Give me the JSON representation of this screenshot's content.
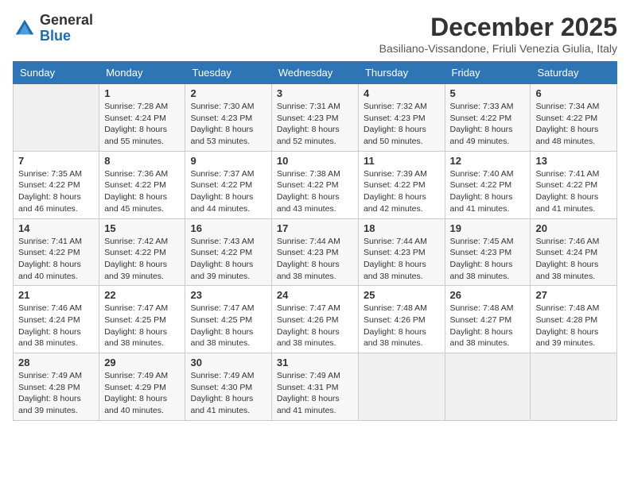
{
  "logo": {
    "general": "General",
    "blue": "Blue"
  },
  "header": {
    "month_title": "December 2025",
    "location": "Basiliano-Vissandone, Friuli Venezia Giulia, Italy"
  },
  "weekdays": [
    "Sunday",
    "Monday",
    "Tuesday",
    "Wednesday",
    "Thursday",
    "Friday",
    "Saturday"
  ],
  "weeks": [
    [
      {
        "day": "",
        "info": ""
      },
      {
        "day": "1",
        "info": "Sunrise: 7:28 AM\nSunset: 4:24 PM\nDaylight: 8 hours\nand 55 minutes."
      },
      {
        "day": "2",
        "info": "Sunrise: 7:30 AM\nSunset: 4:23 PM\nDaylight: 8 hours\nand 53 minutes."
      },
      {
        "day": "3",
        "info": "Sunrise: 7:31 AM\nSunset: 4:23 PM\nDaylight: 8 hours\nand 52 minutes."
      },
      {
        "day": "4",
        "info": "Sunrise: 7:32 AM\nSunset: 4:23 PM\nDaylight: 8 hours\nand 50 minutes."
      },
      {
        "day": "5",
        "info": "Sunrise: 7:33 AM\nSunset: 4:22 PM\nDaylight: 8 hours\nand 49 minutes."
      },
      {
        "day": "6",
        "info": "Sunrise: 7:34 AM\nSunset: 4:22 PM\nDaylight: 8 hours\nand 48 minutes."
      }
    ],
    [
      {
        "day": "7",
        "info": "Sunrise: 7:35 AM\nSunset: 4:22 PM\nDaylight: 8 hours\nand 46 minutes."
      },
      {
        "day": "8",
        "info": "Sunrise: 7:36 AM\nSunset: 4:22 PM\nDaylight: 8 hours\nand 45 minutes."
      },
      {
        "day": "9",
        "info": "Sunrise: 7:37 AM\nSunset: 4:22 PM\nDaylight: 8 hours\nand 44 minutes."
      },
      {
        "day": "10",
        "info": "Sunrise: 7:38 AM\nSunset: 4:22 PM\nDaylight: 8 hours\nand 43 minutes."
      },
      {
        "day": "11",
        "info": "Sunrise: 7:39 AM\nSunset: 4:22 PM\nDaylight: 8 hours\nand 42 minutes."
      },
      {
        "day": "12",
        "info": "Sunrise: 7:40 AM\nSunset: 4:22 PM\nDaylight: 8 hours\nand 41 minutes."
      },
      {
        "day": "13",
        "info": "Sunrise: 7:41 AM\nSunset: 4:22 PM\nDaylight: 8 hours\nand 41 minutes."
      }
    ],
    [
      {
        "day": "14",
        "info": "Sunrise: 7:41 AM\nSunset: 4:22 PM\nDaylight: 8 hours\nand 40 minutes."
      },
      {
        "day": "15",
        "info": "Sunrise: 7:42 AM\nSunset: 4:22 PM\nDaylight: 8 hours\nand 39 minutes."
      },
      {
        "day": "16",
        "info": "Sunrise: 7:43 AM\nSunset: 4:22 PM\nDaylight: 8 hours\nand 39 minutes."
      },
      {
        "day": "17",
        "info": "Sunrise: 7:44 AM\nSunset: 4:23 PM\nDaylight: 8 hours\nand 38 minutes."
      },
      {
        "day": "18",
        "info": "Sunrise: 7:44 AM\nSunset: 4:23 PM\nDaylight: 8 hours\nand 38 minutes."
      },
      {
        "day": "19",
        "info": "Sunrise: 7:45 AM\nSunset: 4:23 PM\nDaylight: 8 hours\nand 38 minutes."
      },
      {
        "day": "20",
        "info": "Sunrise: 7:46 AM\nSunset: 4:24 PM\nDaylight: 8 hours\nand 38 minutes."
      }
    ],
    [
      {
        "day": "21",
        "info": "Sunrise: 7:46 AM\nSunset: 4:24 PM\nDaylight: 8 hours\nand 38 minutes."
      },
      {
        "day": "22",
        "info": "Sunrise: 7:47 AM\nSunset: 4:25 PM\nDaylight: 8 hours\nand 38 minutes."
      },
      {
        "day": "23",
        "info": "Sunrise: 7:47 AM\nSunset: 4:25 PM\nDaylight: 8 hours\nand 38 minutes."
      },
      {
        "day": "24",
        "info": "Sunrise: 7:47 AM\nSunset: 4:26 PM\nDaylight: 8 hours\nand 38 minutes."
      },
      {
        "day": "25",
        "info": "Sunrise: 7:48 AM\nSunset: 4:26 PM\nDaylight: 8 hours\nand 38 minutes."
      },
      {
        "day": "26",
        "info": "Sunrise: 7:48 AM\nSunset: 4:27 PM\nDaylight: 8 hours\nand 38 minutes."
      },
      {
        "day": "27",
        "info": "Sunrise: 7:48 AM\nSunset: 4:28 PM\nDaylight: 8 hours\nand 39 minutes."
      }
    ],
    [
      {
        "day": "28",
        "info": "Sunrise: 7:49 AM\nSunset: 4:28 PM\nDaylight: 8 hours\nand 39 minutes."
      },
      {
        "day": "29",
        "info": "Sunrise: 7:49 AM\nSunset: 4:29 PM\nDaylight: 8 hours\nand 40 minutes."
      },
      {
        "day": "30",
        "info": "Sunrise: 7:49 AM\nSunset: 4:30 PM\nDaylight: 8 hours\nand 41 minutes."
      },
      {
        "day": "31",
        "info": "Sunrise: 7:49 AM\nSunset: 4:31 PM\nDaylight: 8 hours\nand 41 minutes."
      },
      {
        "day": "",
        "info": ""
      },
      {
        "day": "",
        "info": ""
      },
      {
        "day": "",
        "info": ""
      }
    ]
  ]
}
